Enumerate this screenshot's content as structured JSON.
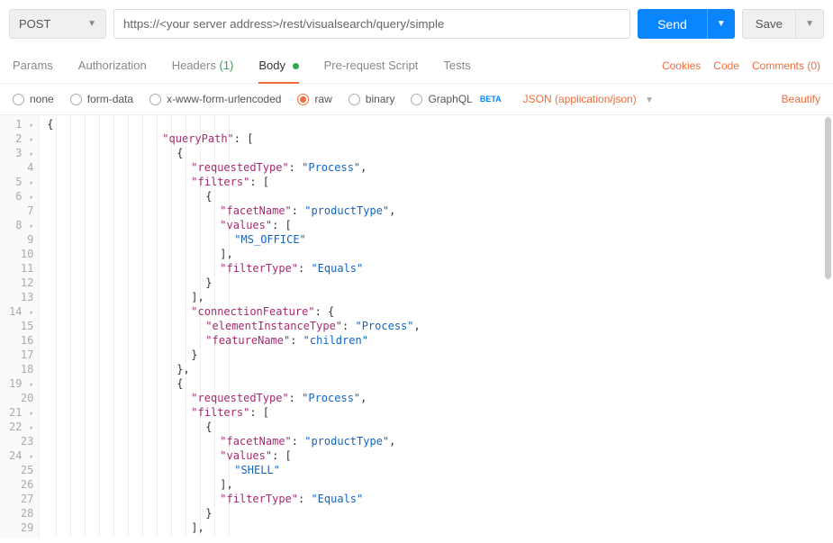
{
  "toolbar": {
    "method": "POST",
    "url": "https://<your server address>/rest/visualsearch/query/simple",
    "send_label": "Send",
    "save_label": "Save"
  },
  "tabs": {
    "params": "Params",
    "authorization": "Authorization",
    "headers": "Headers",
    "headers_count": "(1)",
    "body": "Body",
    "prerequest": "Pre-request Script",
    "tests": "Tests"
  },
  "meta": {
    "cookies": "Cookies",
    "code": "Code",
    "comments": "Comments (0)"
  },
  "body_options": {
    "none": "none",
    "formdata": "form-data",
    "xwww": "x-www-form-urlencoded",
    "raw": "raw",
    "binary": "binary",
    "graphql": "GraphQL",
    "beta": "BETA",
    "content_type": "JSON (application/json)",
    "beautify": "Beautify"
  },
  "editor": {
    "lines": [
      {
        "n": 1,
        "fold": true,
        "indent": 0,
        "tokens": [
          [
            "brace",
            "{"
          ]
        ]
      },
      {
        "n": 2,
        "fold": true,
        "indent": 8,
        "tokens": [
          [
            "key",
            "\"queryPath\""
          ],
          [
            "punc",
            ": ["
          ]
        ]
      },
      {
        "n": 3,
        "fold": true,
        "indent": 9,
        "tokens": [
          [
            "brace",
            "{"
          ]
        ]
      },
      {
        "n": 4,
        "fold": false,
        "indent": 10,
        "tokens": [
          [
            "key",
            "\"requestedType\""
          ],
          [
            "punc",
            ": "
          ],
          [
            "str",
            "\"Process\""
          ],
          [
            "punc",
            ","
          ]
        ]
      },
      {
        "n": 5,
        "fold": true,
        "indent": 10,
        "tokens": [
          [
            "key",
            "\"filters\""
          ],
          [
            "punc",
            ": ["
          ]
        ]
      },
      {
        "n": 6,
        "fold": true,
        "indent": 11,
        "tokens": [
          [
            "brace",
            "{"
          ]
        ]
      },
      {
        "n": 7,
        "fold": false,
        "indent": 12,
        "tokens": [
          [
            "key",
            "\"facetName\""
          ],
          [
            "punc",
            ": "
          ],
          [
            "str",
            "\"productType\""
          ],
          [
            "punc",
            ","
          ]
        ]
      },
      {
        "n": 8,
        "fold": true,
        "indent": 12,
        "tokens": [
          [
            "key",
            "\"values\""
          ],
          [
            "punc",
            ": ["
          ]
        ]
      },
      {
        "n": 9,
        "fold": false,
        "indent": 13,
        "tokens": [
          [
            "str",
            "\"MS_OFFICE\""
          ]
        ]
      },
      {
        "n": 10,
        "fold": false,
        "indent": 12,
        "tokens": [
          [
            "punc",
            "],"
          ]
        ]
      },
      {
        "n": 11,
        "fold": false,
        "indent": 12,
        "tokens": [
          [
            "key",
            "\"filterType\""
          ],
          [
            "punc",
            ": "
          ],
          [
            "str",
            "\"Equals\""
          ]
        ]
      },
      {
        "n": 12,
        "fold": false,
        "indent": 11,
        "tokens": [
          [
            "brace",
            "}"
          ]
        ]
      },
      {
        "n": 13,
        "fold": false,
        "indent": 10,
        "tokens": [
          [
            "punc",
            "],"
          ]
        ]
      },
      {
        "n": 14,
        "fold": true,
        "indent": 10,
        "tokens": [
          [
            "key",
            "\"connectionFeature\""
          ],
          [
            "punc",
            ": {"
          ]
        ]
      },
      {
        "n": 15,
        "fold": false,
        "indent": 11,
        "tokens": [
          [
            "key",
            "\"elementInstanceType\""
          ],
          [
            "punc",
            ": "
          ],
          [
            "str",
            "\"Process\""
          ],
          [
            "punc",
            ","
          ]
        ]
      },
      {
        "n": 16,
        "fold": false,
        "indent": 11,
        "tokens": [
          [
            "key",
            "\"featureName\""
          ],
          [
            "punc",
            ": "
          ],
          [
            "str",
            "\"children\""
          ]
        ]
      },
      {
        "n": 17,
        "fold": false,
        "indent": 10,
        "tokens": [
          [
            "brace",
            "}"
          ]
        ]
      },
      {
        "n": 18,
        "fold": false,
        "indent": 9,
        "tokens": [
          [
            "brace",
            "},"
          ]
        ]
      },
      {
        "n": 19,
        "fold": true,
        "indent": 9,
        "tokens": [
          [
            "brace",
            "{"
          ]
        ]
      },
      {
        "n": 20,
        "fold": false,
        "indent": 10,
        "tokens": [
          [
            "key",
            "\"requestedType\""
          ],
          [
            "punc",
            ": "
          ],
          [
            "str",
            "\"Process\""
          ],
          [
            "punc",
            ","
          ]
        ]
      },
      {
        "n": 21,
        "fold": true,
        "indent": 10,
        "tokens": [
          [
            "key",
            "\"filters\""
          ],
          [
            "punc",
            ": ["
          ]
        ]
      },
      {
        "n": 22,
        "fold": true,
        "indent": 11,
        "tokens": [
          [
            "brace",
            "{"
          ]
        ]
      },
      {
        "n": 23,
        "fold": false,
        "indent": 12,
        "tokens": [
          [
            "key",
            "\"facetName\""
          ],
          [
            "punc",
            ": "
          ],
          [
            "str",
            "\"productType\""
          ],
          [
            "punc",
            ","
          ]
        ]
      },
      {
        "n": 24,
        "fold": true,
        "indent": 12,
        "tokens": [
          [
            "key",
            "\"values\""
          ],
          [
            "punc",
            ": ["
          ]
        ]
      },
      {
        "n": 25,
        "fold": false,
        "indent": 13,
        "tokens": [
          [
            "str",
            "\"SHELL\""
          ]
        ]
      },
      {
        "n": 26,
        "fold": false,
        "indent": 12,
        "tokens": [
          [
            "punc",
            "],"
          ]
        ]
      },
      {
        "n": 27,
        "fold": false,
        "indent": 12,
        "tokens": [
          [
            "key",
            "\"filterType\""
          ],
          [
            "punc",
            ": "
          ],
          [
            "str",
            "\"Equals\""
          ]
        ]
      },
      {
        "n": 28,
        "fold": false,
        "indent": 11,
        "tokens": [
          [
            "brace",
            "}"
          ]
        ]
      },
      {
        "n": 29,
        "fold": false,
        "indent": 10,
        "tokens": [
          [
            "punc",
            "],"
          ]
        ]
      }
    ]
  }
}
